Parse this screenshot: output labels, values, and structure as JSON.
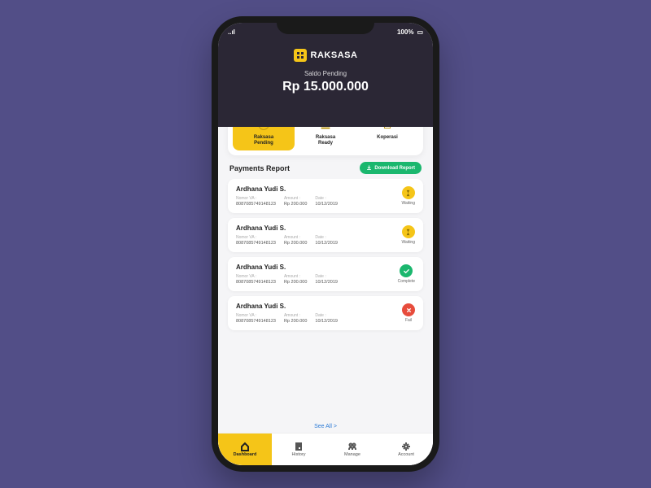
{
  "statusbar": {
    "signal": "..ıl",
    "wifi": "⌃",
    "battery": "100%",
    "battery_icon": "▭"
  },
  "brand": {
    "name": "RAKSASA"
  },
  "balance": {
    "label": "Saldo Pending",
    "value": "Rp 15.000.000"
  },
  "tabs": [
    {
      "label": "Raksasa\nPending",
      "active": true,
      "icon": "coin"
    },
    {
      "label": "Raksasa\nReady",
      "active": false,
      "icon": "hand-coin"
    },
    {
      "label": "Koperasi",
      "active": false,
      "icon": "shop"
    }
  ],
  "report": {
    "title": "Payments Report",
    "download_label": "Download Report",
    "see_all_label": "See All >"
  },
  "meta_labels": {
    "va": "Nomor VA :",
    "amount": "Amount :",
    "date": "Date :"
  },
  "transactions": [
    {
      "name": "Ardhana Yudi S.",
      "va": "8087085749148123",
      "amount": "Rp 200.000",
      "date": "10/12/2019",
      "status": "waiting",
      "status_label": "Waiting"
    },
    {
      "name": "Ardhana Yudi S.",
      "va": "8087085749148123",
      "amount": "Rp 200.000",
      "date": "10/12/2019",
      "status": "waiting",
      "status_label": "Waiting"
    },
    {
      "name": "Ardhana Yudi S.",
      "va": "8087085749148123",
      "amount": "Rp 200.000",
      "date": "10/12/2019",
      "status": "complete",
      "status_label": "Complete"
    },
    {
      "name": "Ardhana Yudi S.",
      "va": "8087085749148123",
      "amount": "Rp 200.000",
      "date": "10/12/2019",
      "status": "fail",
      "status_label": "Fail"
    }
  ],
  "nav": [
    {
      "label": "Dashboard",
      "icon": "home",
      "active": true
    },
    {
      "label": "History",
      "icon": "receipt",
      "active": false
    },
    {
      "label": "Manage",
      "icon": "users",
      "active": false
    },
    {
      "label": "Account",
      "icon": "gear",
      "active": false
    }
  ]
}
